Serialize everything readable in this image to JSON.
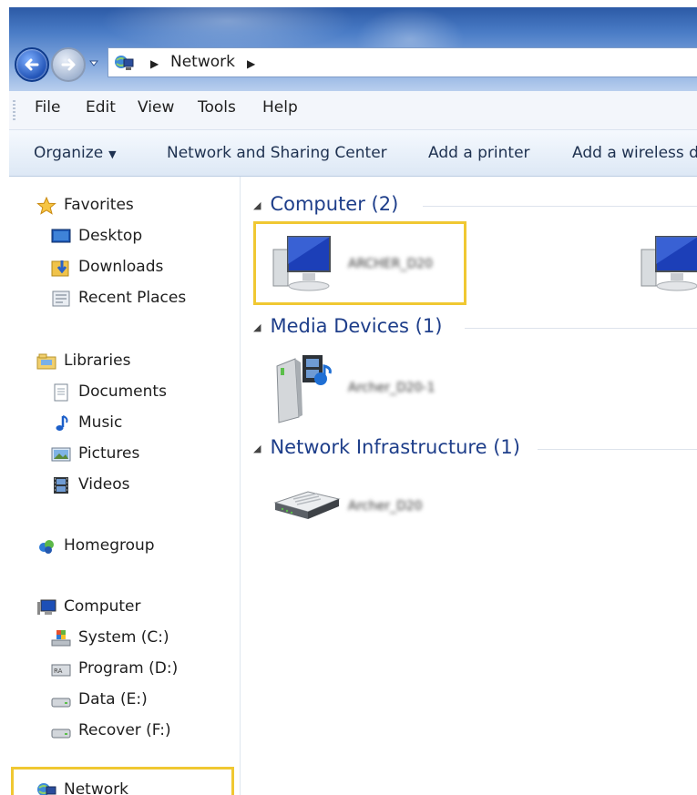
{
  "address": {
    "location": "Network"
  },
  "menu": [
    "File",
    "Edit",
    "View",
    "Tools",
    "Help"
  ],
  "commands": {
    "organize": "Organize",
    "network_sharing": "Network and Sharing Center",
    "add_printer": "Add a printer",
    "add_wireless": "Add a wireless d"
  },
  "nav": {
    "favorites": "Favorites",
    "desktop": "Desktop",
    "downloads": "Downloads",
    "recent": "Recent Places",
    "libraries": "Libraries",
    "documents": "Documents",
    "music": "Music",
    "pictures": "Pictures",
    "videos": "Videos",
    "homegroup": "Homegroup",
    "computer": "Computer",
    "system": "System (C:)",
    "program": "Program (D:)",
    "data": "Data (E:)",
    "recover": "Recover (F:)",
    "network": "Network"
  },
  "groups": {
    "computer": "Computer (2)",
    "media": "Media Devices (1)",
    "infra": "Network Infrastructure (1)"
  },
  "items": {
    "computer1": "ARCHER_D20",
    "media1": "Archer_D20-1",
    "router1": "Archer_D20"
  },
  "icons": [
    "back-arrow-icon",
    "forward-arrow-icon",
    "network-icon",
    "star-icon",
    "desktop-icon",
    "downloads-icon",
    "recent-places-icon",
    "libraries-icon",
    "document-icon",
    "music-icon",
    "pictures-icon",
    "videos-icon",
    "homegroup-icon",
    "computer-icon",
    "system-drive-icon",
    "program-drive-icon",
    "data-drive-icon",
    "recover-drive-icon",
    "computer-device-icon",
    "media-device-icon",
    "router-icon"
  ],
  "colors": {
    "highlight": "#f0c832",
    "group_header": "#1e3e8a",
    "titlebar": "#4a7cc6"
  }
}
